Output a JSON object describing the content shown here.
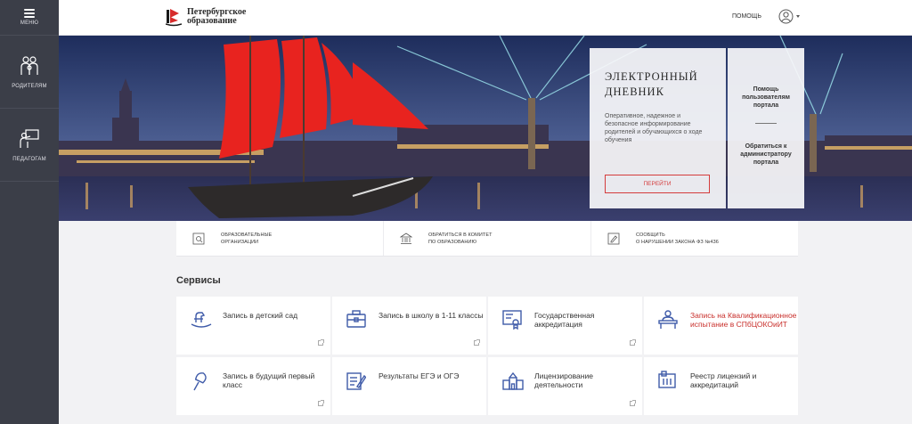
{
  "sidebar": {
    "menu_label": "МЕНЮ",
    "items": [
      {
        "label": "РОДИТЕЛЯМ",
        "icon": "parents-icon"
      },
      {
        "label": "ПЕДАГОГАМ",
        "icon": "teachers-icon"
      }
    ]
  },
  "header": {
    "logo_line1": "Петербургское",
    "logo_line2": "образование",
    "help_link": "ПОМОЩЬ",
    "user_icon": "user-icon"
  },
  "hero": {
    "diary_title_line1": "ЭЛЕКТРОННЫЙ",
    "diary_title_line2": "ДНЕВНИК",
    "diary_description": "Оперативное, надежное и безопасное информирование родителей и обучающихся о ходе обучения",
    "go_button": "ПЕРЕЙТИ",
    "help_users": "Помощь пользователям портала",
    "contact_admin": "Обратиться к администратору портала"
  },
  "quick_links": [
    {
      "line1": "ОБРАЗОВАТЕЛЬНЫЕ",
      "line2": "ОРГАНИЗАЦИИ",
      "icon": "search-document-icon"
    },
    {
      "line1": "ОБРАТИТЬСЯ В КОМИТЕТ",
      "line2": "ПО ОБРАЗОВАНИЮ",
      "icon": "building-icon"
    },
    {
      "line1": "СООБЩИТЬ",
      "line2": "О НАРУШЕНИИ ЗАКОНА ФЗ №436",
      "icon": "report-icon"
    }
  ],
  "services": {
    "title": "Сервисы",
    "cards": [
      {
        "label": "Запись в детский сад",
        "icon": "rocking-horse-icon",
        "highlight": false,
        "external": true
      },
      {
        "label": "Запись в школу в 1-11 классы",
        "icon": "briefcase-icon",
        "highlight": false,
        "external": true
      },
      {
        "label": "Государственная аккредитация",
        "icon": "certificate-icon",
        "highlight": false,
        "external": true
      },
      {
        "label": "Запись на Квалификационное испытание в СПбЦОКОиИТ",
        "icon": "exam-desk-icon",
        "highlight": true,
        "external": false
      },
      {
        "label": "Запись в будущий первый класс",
        "icon": "bell-icon",
        "highlight": false,
        "external": true
      },
      {
        "label": "Результаты ЕГЭ и ОГЭ",
        "icon": "results-icon",
        "highlight": false,
        "external": false
      },
      {
        "label": "Лицензирование деятельности",
        "icon": "school-building-icon",
        "highlight": false,
        "external": true
      },
      {
        "label": "Реестр лицензий и аккредитаций",
        "icon": "registry-icon",
        "highlight": false,
        "external": false
      }
    ]
  },
  "colors": {
    "sidebar_bg": "#3b3e48",
    "accent_red": "#d43c3c",
    "icon_blue": "#3f5ba9"
  }
}
